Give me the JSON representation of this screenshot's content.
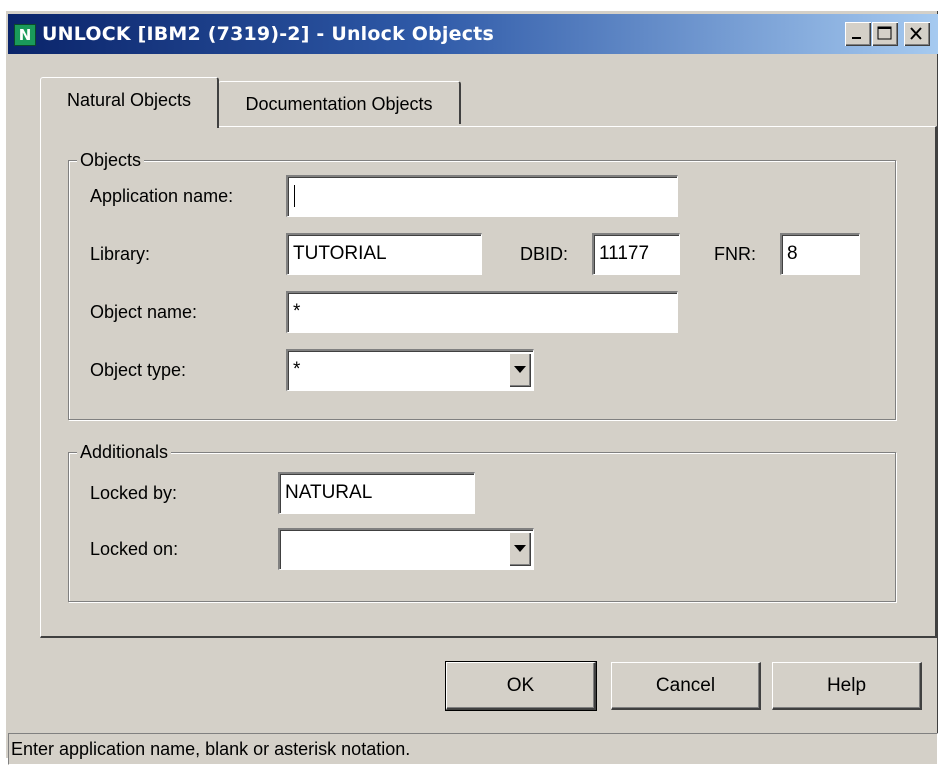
{
  "window": {
    "icon_letter": "N",
    "title": "UNLOCK [IBM2 (7319)-2] - Unlock Objects",
    "controls": [
      "minimize-icon",
      "maximize-icon",
      "close-icon"
    ]
  },
  "tabs": [
    {
      "label": "Natural Objects",
      "active": true
    },
    {
      "label": "Documentation Objects",
      "active": false
    }
  ],
  "objects": {
    "legend": "Objects",
    "application_name": {
      "label": "Application name:",
      "value": ""
    },
    "library": {
      "label": "Library:",
      "value": "TUTORIAL"
    },
    "dbid": {
      "label": "DBID:",
      "value": "11177"
    },
    "fnr": {
      "label": "FNR:",
      "value": "8"
    },
    "object_name": {
      "label": "Object name:",
      "value": "*"
    },
    "object_type": {
      "label": "Object type:",
      "value": "*"
    }
  },
  "additionals": {
    "legend": "Additionals",
    "locked_by": {
      "label": "Locked by:",
      "value": "NATURAL"
    },
    "locked_on": {
      "label": "Locked on:",
      "value": ""
    }
  },
  "buttons": {
    "ok": "OK",
    "cancel": "Cancel",
    "help": "Help"
  },
  "status": "Enter application name, blank or asterisk notation.",
  "colors": {
    "title_start": "#0a246a",
    "title_end": "#a6caf0",
    "face": "#d4d0c8"
  }
}
